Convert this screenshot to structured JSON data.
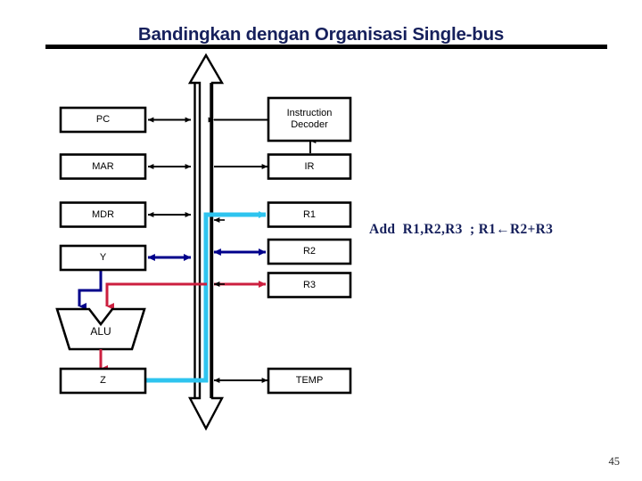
{
  "slide": {
    "title": "Bandingkan dengan Organisasi Single-bus",
    "page_number": "45",
    "title_color": "#16205c",
    "rule_color": "#000000",
    "background": "#ffffff"
  },
  "annotation": {
    "text": "Add  R1,R2,R3  ; R1←R2+R3",
    "color": "#16205c"
  },
  "diagram": {
    "bus": {
      "name": "single-bus",
      "style": "hollow-double-headed-vertical-arrow",
      "color": "#000000",
      "line_color": "#000000"
    },
    "colors": {
      "black": "#000000",
      "navy": "#00008b",
      "cyan": "#2ec4ef",
      "red": "#cc1f3f",
      "white": "#ffffff"
    },
    "left_boxes": [
      {
        "id": "pc",
        "label": "PC"
      },
      {
        "id": "mar",
        "label": "MAR"
      },
      {
        "id": "mdr",
        "label": "MDR"
      },
      {
        "id": "y",
        "label": "Y"
      },
      {
        "id": "z",
        "label": "Z"
      }
    ],
    "right_boxes": [
      {
        "id": "instruction-decoder",
        "label": "Instruction\nDecoder"
      },
      {
        "id": "ir",
        "label": "IR"
      },
      {
        "id": "r1",
        "label": "R1"
      },
      {
        "id": "r2",
        "label": "R2"
      },
      {
        "id": "r3",
        "label": "R3"
      },
      {
        "id": "temp",
        "label": "TEMP"
      }
    ],
    "alu": {
      "id": "alu",
      "label": "ALU"
    },
    "connections": [
      {
        "from": "bus",
        "to": "pc",
        "color": "#000000",
        "arrows": "double"
      },
      {
        "from": "instruction-decoder",
        "to": "bus",
        "color": "#000000",
        "arrows": "single"
      },
      {
        "from": "bus",
        "to": "mar",
        "color": "#000000",
        "arrows": "double"
      },
      {
        "from": "bus",
        "to": "ir",
        "color": "#000000",
        "arrows": "single"
      },
      {
        "from": "ir",
        "to": "instruction-decoder",
        "color": "#000000",
        "arrows": "single"
      },
      {
        "from": "bus",
        "to": "mdr",
        "color": "#000000",
        "arrows": "double"
      },
      {
        "from": "z",
        "to": "r1",
        "color": "#2ec4ef",
        "arrows": "single"
      },
      {
        "from": "r2",
        "to": "y",
        "color": "#00008b",
        "arrows": "double"
      },
      {
        "from": "r3",
        "to": "alu",
        "color": "#cc1f3f",
        "arrows": "single"
      },
      {
        "from": "y",
        "to": "alu",
        "color": "#00008b",
        "arrows": "single"
      },
      {
        "from": "alu",
        "to": "z",
        "color": "#cc1f3f",
        "arrows": "single"
      },
      {
        "from": "bus",
        "to": "temp",
        "color": "#000000",
        "arrows": "double"
      }
    ]
  }
}
